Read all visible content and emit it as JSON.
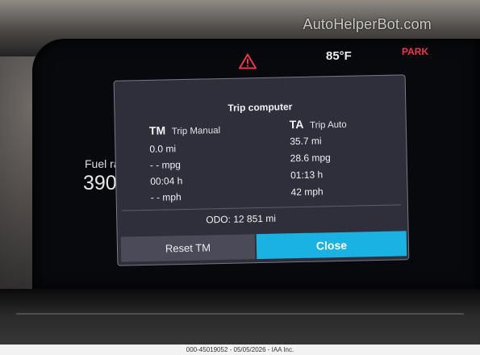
{
  "watermark": "AutoHelperBot.com",
  "status_bar": {
    "temperature": "85°F",
    "gear": "PARK",
    "warning_icon": "warning-triangle-icon",
    "warning_color": "#e8384a"
  },
  "gauge": {
    "fuel_label": "Fuel ra",
    "fuel_value": "390"
  },
  "trip_computer": {
    "title": "Trip computer",
    "trip_manual": {
      "abbr": "TM",
      "name": "Trip Manual",
      "distance": "0.0 mi",
      "economy": "- - mpg",
      "time": "00:04 h",
      "speed": "- - mph"
    },
    "trip_auto": {
      "abbr": "TA",
      "name": "Trip Auto",
      "distance": "35.7 mi",
      "economy": "28.6 mpg",
      "time": "01:13 h",
      "speed": "42 mph"
    },
    "odometer": "ODO:  12 851 mi",
    "reset_button": "Reset TM",
    "close_button": "Close",
    "accent_color": "#1ab1e3"
  },
  "caption": "000-45019052 - 05/05/2026 - IAA Inc."
}
